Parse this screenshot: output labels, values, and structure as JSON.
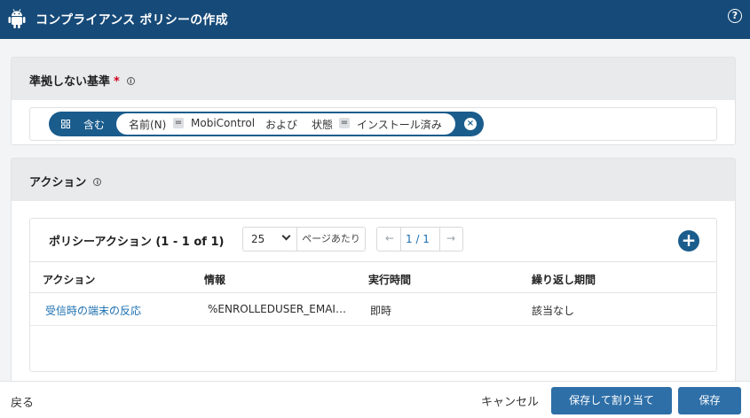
{
  "window": {
    "title": "コンプライアンス ポリシーの作成",
    "help": "?"
  },
  "criteria": {
    "heading": "準拠しない基準",
    "required_mark": "*",
    "info": "i",
    "filter": {
      "contains_label": "含む",
      "field1": "名前(N)",
      "op1": "=",
      "value1": "MobiControl",
      "conjunction": "および",
      "field2": "状態",
      "op2": "=",
      "value2": "インストール済み",
      "remove": "×"
    }
  },
  "actions": {
    "heading": "アクション",
    "info": "i",
    "table_title": "ポリシーアクション (1 - 1 of 1)",
    "per_page_value": "25",
    "per_page_label": "ページあたり",
    "pager": {
      "prev": "←",
      "page": "1 / 1",
      "next": "→"
    },
    "add": "+",
    "columns": [
      "アクション",
      "情報",
      "実行時間",
      "繰り返し期間"
    ],
    "rows": [
      {
        "action": "受信時の端末の反応",
        "info": "%ENROLLEDUSER_EMAI…",
        "time": "即時",
        "repeat": "該当なし"
      }
    ]
  },
  "footer": {
    "back": "戻る",
    "cancel": "キャンセル",
    "save_assign": "保存して割り当て",
    "save": "保存"
  },
  "colors": {
    "titlebar": "#164a78",
    "accent": "#1a5c8c",
    "link": "#1a6fb0",
    "button": "#2e6fa8"
  }
}
